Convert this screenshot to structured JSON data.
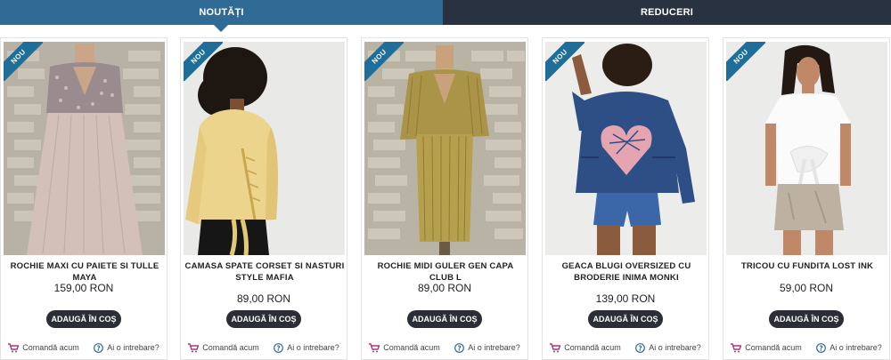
{
  "tabs": [
    {
      "label": "NOUTĂȚI"
    },
    {
      "label": "Reduceri"
    }
  ],
  "badge_label": "NOU",
  "colors": {
    "tab_active": "#2f6b95",
    "tab_inactive": "#283240",
    "button": "#2b2e36",
    "badge": "#1f6e9a",
    "cart_icon": "#b0357a",
    "question_icon": "#2f6b95"
  },
  "actions": {
    "order_now": "Comandă acum",
    "question": "Ai o intrebare?"
  },
  "add_to_cart_label": "ADAUGĂ ÎN COȘ",
  "products": [
    {
      "title": "CAMASA SPATE CORSET SI NASTURI STYLE MAFIA",
      "price": "89,00 RON",
      "image": "woman in yellow blouse with corset back"
    },
    {
      "title": "ROCHIE MIDI GULER GEN CAPA CLUB L",
      "price": "89,00 RON",
      "image": "gold pleated midi dress on mannequin"
    },
    {
      "title": "GEACA BLUGI OVERSIZED CU BRODERIE INIMA MONKI",
      "price": "139,00 RON",
      "image": "denim jacket with embroidered heart"
    },
    {
      "title": "TRICOU CU FUNDITA LOST INK",
      "price": "59,00 RON",
      "image": "white t-shirt with bow and metallic skirt"
    },
    {
      "title": "ROCHIE MAXI CU PAIETE SI TULLE MAYA",
      "price": "159,00 RON",
      "image": "sequin maxi dress with tulle skirt"
    }
  ]
}
